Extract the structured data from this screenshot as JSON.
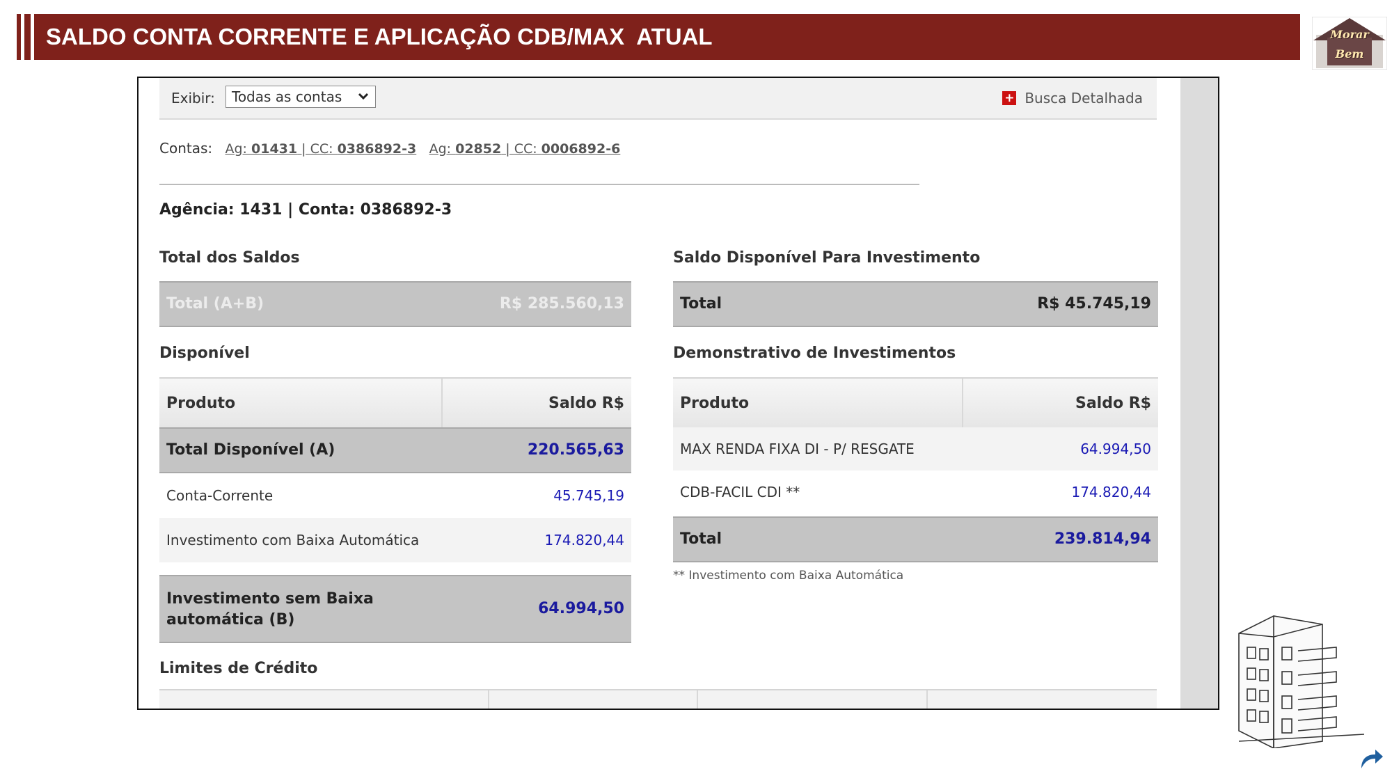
{
  "slide": {
    "title": "SALDO CONTA CORRENTE E APLICAÇÃO CDB/MAX  ATUAL",
    "logo_line1": "Morar",
    "logo_line2": "Bem",
    "header_color": "#7f211b"
  },
  "toolbar": {
    "exibir_label": "Exibir:",
    "exibir_value": "Todas as contas",
    "busca_label": "Busca Detalhada",
    "busca_icon": "plus-icon"
  },
  "contas": {
    "label": "Contas:",
    "accounts": [
      {
        "ag_prefix": "Ag: ",
        "ag": "01431",
        "sep": " | ",
        "cc_prefix": "CC: ",
        "cc": "0386892-3"
      },
      {
        "ag_prefix": "Ag: ",
        "ag": "02852",
        "sep": " | ",
        "cc_prefix": "CC: ",
        "cc": "0006892-6"
      }
    ]
  },
  "agencia_line": "Agência: 1431 | Conta: 0386892-3",
  "total_saldos": {
    "title": "Total dos Saldos",
    "label": "Total (A+B)",
    "value": "R$ 285.560,13"
  },
  "saldo_investimento": {
    "title": "Saldo Disponível Para Investimento",
    "label": "Total",
    "value": "R$ 45.745,19"
  },
  "disponivel": {
    "title": "Disponível",
    "col_produto": "Produto",
    "col_saldo": "Saldo R$",
    "total_label": "Total Disponível (A)",
    "total_value": "220.565,63",
    "rows": [
      {
        "produto": "Conta-Corrente",
        "saldo": "45.745,19"
      },
      {
        "produto": "Investimento com Baixa Automática",
        "saldo": "174.820,44"
      }
    ],
    "sem_baixa_label_1": "Investimento sem Baixa",
    "sem_baixa_label_2": "automática (B)",
    "sem_baixa_value": "64.994,50"
  },
  "demonstrativo": {
    "title": "Demonstrativo de Investimentos",
    "col_produto": "Produto",
    "col_saldo": "Saldo R$",
    "rows": [
      {
        "produto": "MAX RENDA FIXA DI - P/ RESGATE",
        "saldo": "64.994,50"
      },
      {
        "produto": "CDB-FACIL CDI **",
        "saldo": "174.820,44"
      }
    ],
    "total_label": "Total",
    "total_value": "239.814,94",
    "footnote": "** Investimento com Baixa Automática"
  },
  "limites": {
    "title": "Limites de Crédito"
  }
}
